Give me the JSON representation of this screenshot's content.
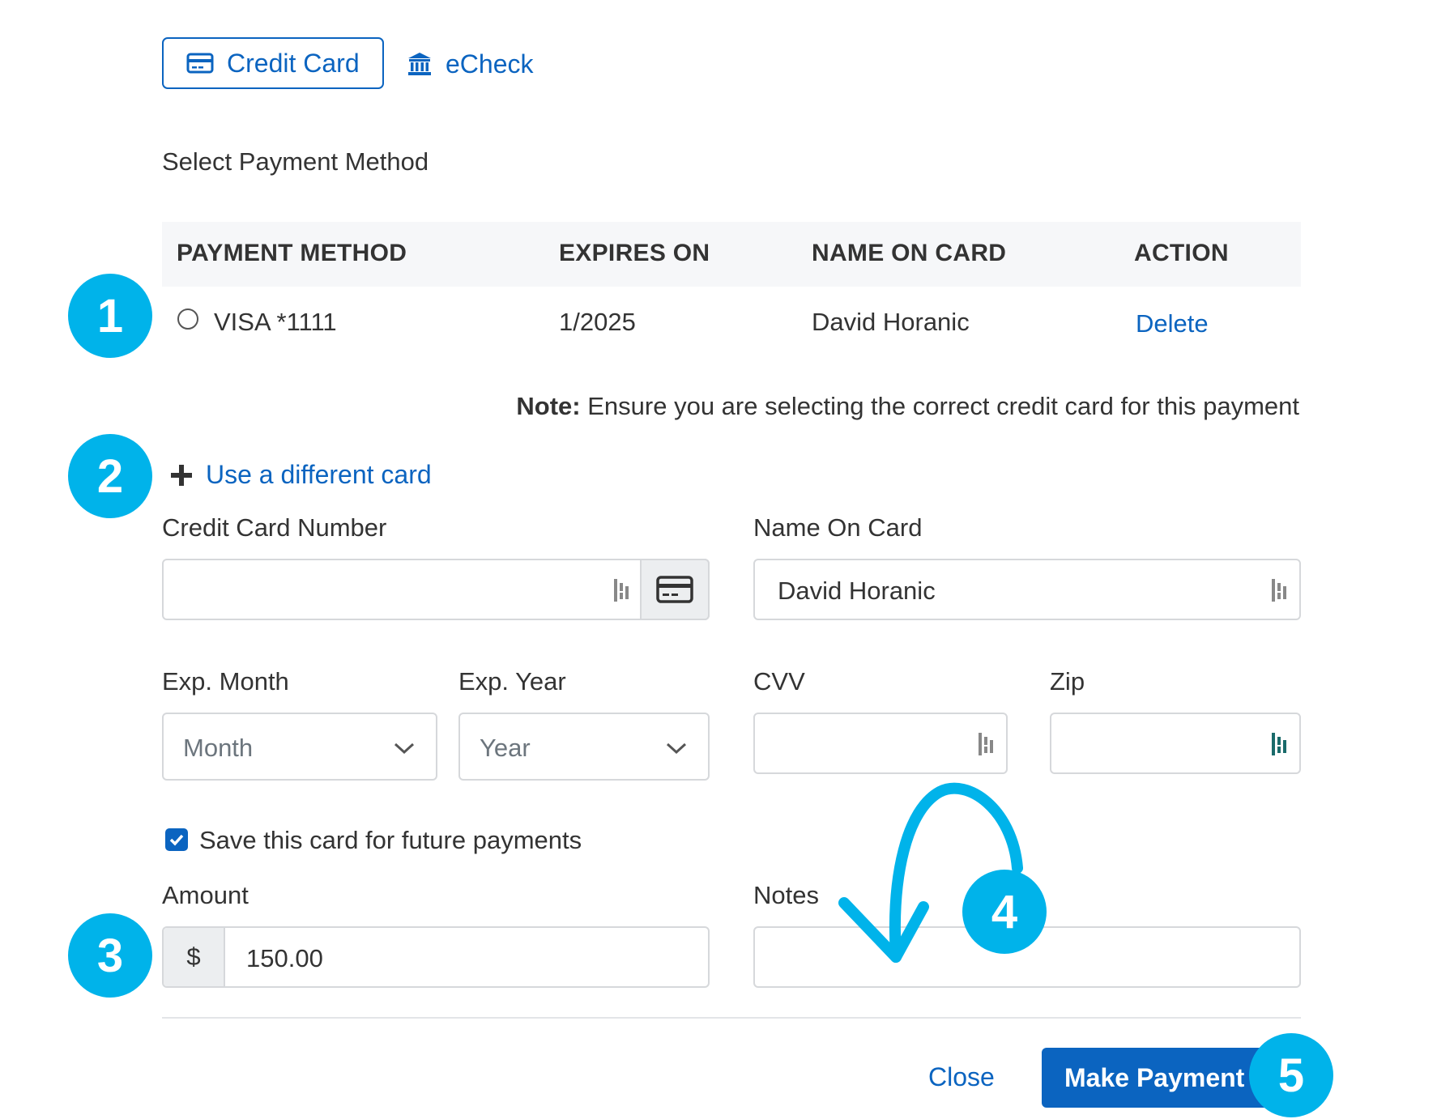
{
  "tabs": {
    "credit_card": "Credit Card",
    "echeck": "eCheck"
  },
  "section_title": "Select Payment Method",
  "table": {
    "headers": [
      "PAYMENT METHOD",
      "EXPIRES ON",
      "NAME ON CARD",
      "ACTION"
    ],
    "rows": [
      {
        "method": "VISA *1111",
        "expires": "1/2025",
        "name": "David Horanic",
        "action": "Delete"
      }
    ]
  },
  "note": {
    "label": "Note:",
    "text": " Ensure you are selecting the correct credit card for this payment"
  },
  "use_different_card": "Use a different card",
  "form": {
    "cc_number_label": "Credit Card Number",
    "cc_number_value": "",
    "name_label": "Name On Card",
    "name_value": "David Horanic",
    "exp_month_label": "Exp. Month",
    "exp_month_value": "Month",
    "exp_year_label": "Exp. Year",
    "exp_year_value": "Year",
    "cvv_label": "CVV",
    "zip_label": "Zip",
    "save_card_label": "Save this card for future payments",
    "save_card_checked": true,
    "amount_label": "Amount",
    "currency_symbol": "$",
    "amount_value": "150.00",
    "notes_label": "Notes",
    "notes_value": ""
  },
  "footer": {
    "close": "Close",
    "submit": "Make Payment"
  },
  "callouts": [
    "1",
    "2",
    "3",
    "4",
    "5"
  ],
  "colors": {
    "accent": "#0b64c0",
    "callout": "#00b3ea",
    "header_bg": "#f6f7f9"
  },
  "icons": [
    "credit-card-icon",
    "bank-icon",
    "plus-icon",
    "chevron-down-icon",
    "autofill-icon",
    "check-icon",
    "curved-arrow"
  ]
}
